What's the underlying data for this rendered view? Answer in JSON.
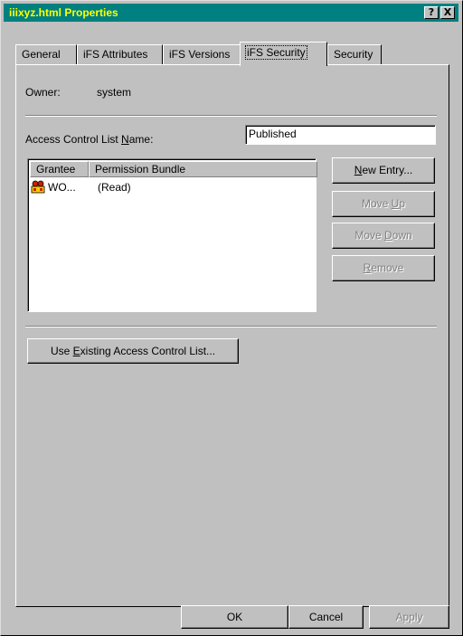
{
  "window": {
    "title": "iiixyz.html Properties",
    "help_glyph": "?",
    "close_glyph": "X"
  },
  "tabs": [
    {
      "label": "General",
      "active": false
    },
    {
      "label": "iFS Attributes",
      "active": false
    },
    {
      "label": "iFS Versions",
      "active": false
    },
    {
      "label": "iFS Security",
      "active": true
    },
    {
      "label": "Security",
      "active": false
    }
  ],
  "owner": {
    "label": "Owner:",
    "value": "system"
  },
  "acl": {
    "label_pre": "Access Control List ",
    "label_mnemonic": "N",
    "label_post": "ame:",
    "value": "Published"
  },
  "list": {
    "columns": [
      "Grantee",
      "Permission Bundle"
    ],
    "rows": [
      {
        "grantee": "WO...",
        "permission": "(Read)",
        "icon": "group-users-icon"
      }
    ]
  },
  "side_buttons": {
    "new_entry": {
      "mn": "N",
      "rest": "ew Entry...",
      "enabled": true
    },
    "move_up": {
      "pre": "Move ",
      "mn": "U",
      "post": "p",
      "enabled": false
    },
    "move_down": {
      "pre": "Move ",
      "mn": "D",
      "post": "own",
      "enabled": false
    },
    "remove": {
      "mn": "R",
      "rest": "emove",
      "enabled": false
    }
  },
  "use_existing": {
    "pre": "Use ",
    "mn": "E",
    "post": "xisting Access Control List..."
  },
  "footer": {
    "ok": "OK",
    "cancel": "Cancel",
    "apply": "Apply"
  },
  "colors": {
    "titlebar": "#008080",
    "title_text": "#ffff00",
    "face": "#c0c0c0"
  }
}
